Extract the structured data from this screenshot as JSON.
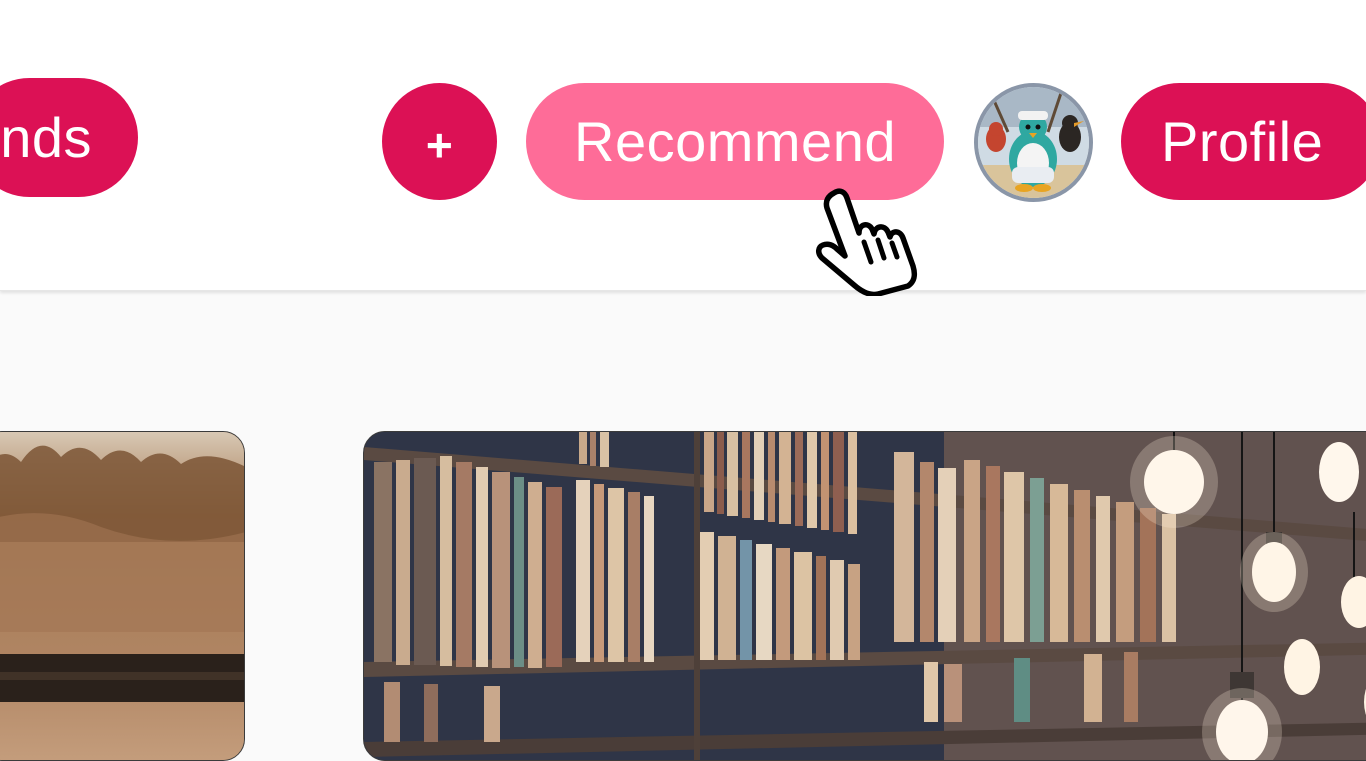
{
  "header": {
    "friends_label": "nds",
    "add_label": "+",
    "recommend_label": "Recommend",
    "profile_label": "Profile",
    "avatar_alt": "user avatar"
  },
  "colors": {
    "primary": "#dc1155",
    "primary_hover": "#fe6c98",
    "page_background": "#fafafa",
    "header_background": "#ffffff"
  },
  "icons": {
    "cursor": "hand-pointer-icon",
    "avatar": "penguin-avatar-icon"
  },
  "cards": [
    {
      "name": "forest-sunset-image"
    },
    {
      "name": "library-bookshelf-image"
    }
  ]
}
